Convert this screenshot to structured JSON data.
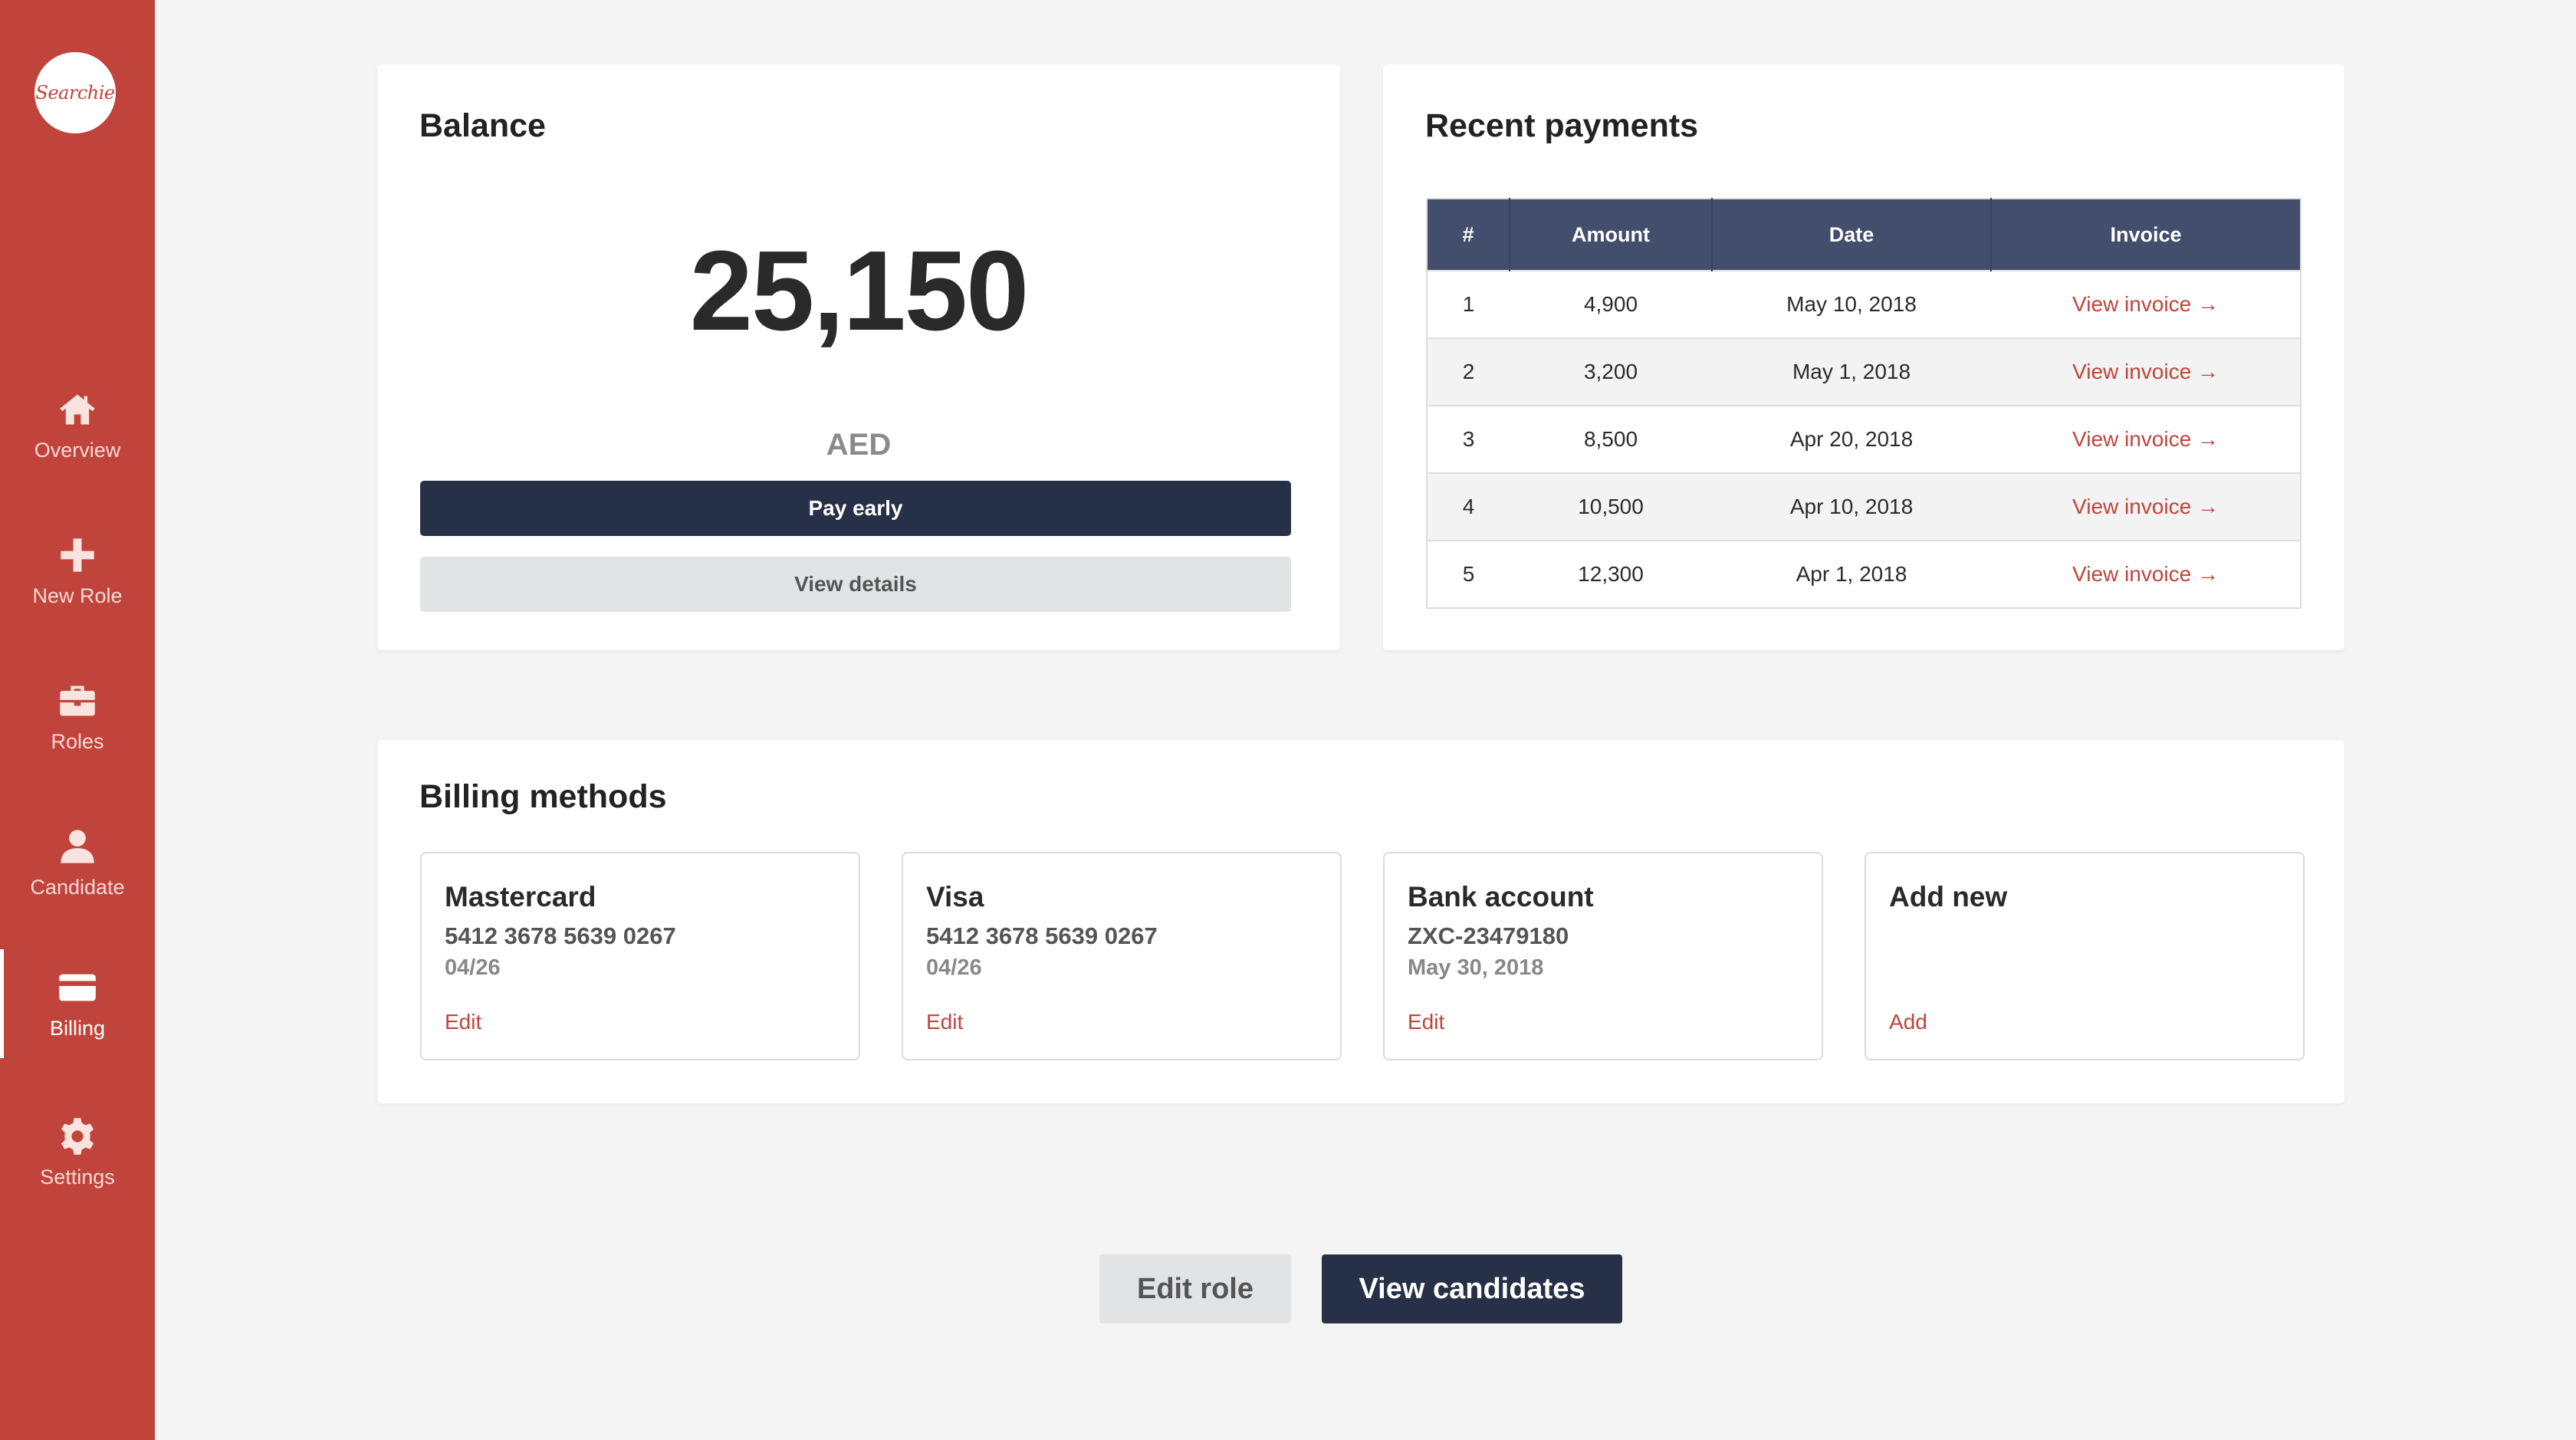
{
  "brand": {
    "logo_text": "Searchie",
    "accent_color": "#c0443b",
    "navy_color": "#263047"
  },
  "sidebar": {
    "items": [
      {
        "label": "Overview",
        "icon": "home-icon",
        "active": false
      },
      {
        "label": "New Role",
        "icon": "plus-icon",
        "active": false
      },
      {
        "label": "Roles",
        "icon": "briefcase-icon",
        "active": false
      },
      {
        "label": "Candidate",
        "icon": "user-icon",
        "active": false
      },
      {
        "label": "Billing",
        "icon": "credit-card-icon",
        "active": true
      },
      {
        "label": "Settings",
        "icon": "gear-icon",
        "active": false
      }
    ]
  },
  "balance": {
    "title": "Balance",
    "amount": "25,150",
    "currency": "AED",
    "pay_early_label": "Pay early",
    "view_details_label": "View details"
  },
  "payments": {
    "title": "Recent payments",
    "columns": [
      "#",
      "Amount",
      "Date",
      "Invoice"
    ],
    "rows": [
      {
        "num": "1",
        "amount": "4,900",
        "date": "May 10, 2018",
        "invoice": "View invoice →"
      },
      {
        "num": "2",
        "amount": "3,200",
        "date": "May 1, 2018",
        "invoice": "View invoice →"
      },
      {
        "num": "3",
        "amount": "8,500",
        "date": "Apr 20, 2018",
        "invoice": "View invoice →"
      },
      {
        "num": "4",
        "amount": "10,500",
        "date": "Apr 10, 2018",
        "invoice": "View invoice →"
      },
      {
        "num": "5",
        "amount": "12,300",
        "date": "Apr 1, 2018",
        "invoice": "View invoice →"
      }
    ]
  },
  "billing": {
    "title": "Billing methods",
    "methods": [
      {
        "name": "Mastercard",
        "number": "5412 3678 5639 0267",
        "sub": "04/26",
        "action": "Edit"
      },
      {
        "name": "Visa",
        "number": "5412 3678 5639 0267",
        "sub": "04/26",
        "action": "Edit"
      },
      {
        "name": "Bank account",
        "number": "ZXC-23479180",
        "sub": "May 30, 2018",
        "action": "Edit"
      },
      {
        "name": "Add new",
        "number": "",
        "sub": "",
        "action": "Add"
      }
    ]
  },
  "footer": {
    "edit_role_label": "Edit role",
    "view_candidates_label": "View candidates"
  }
}
